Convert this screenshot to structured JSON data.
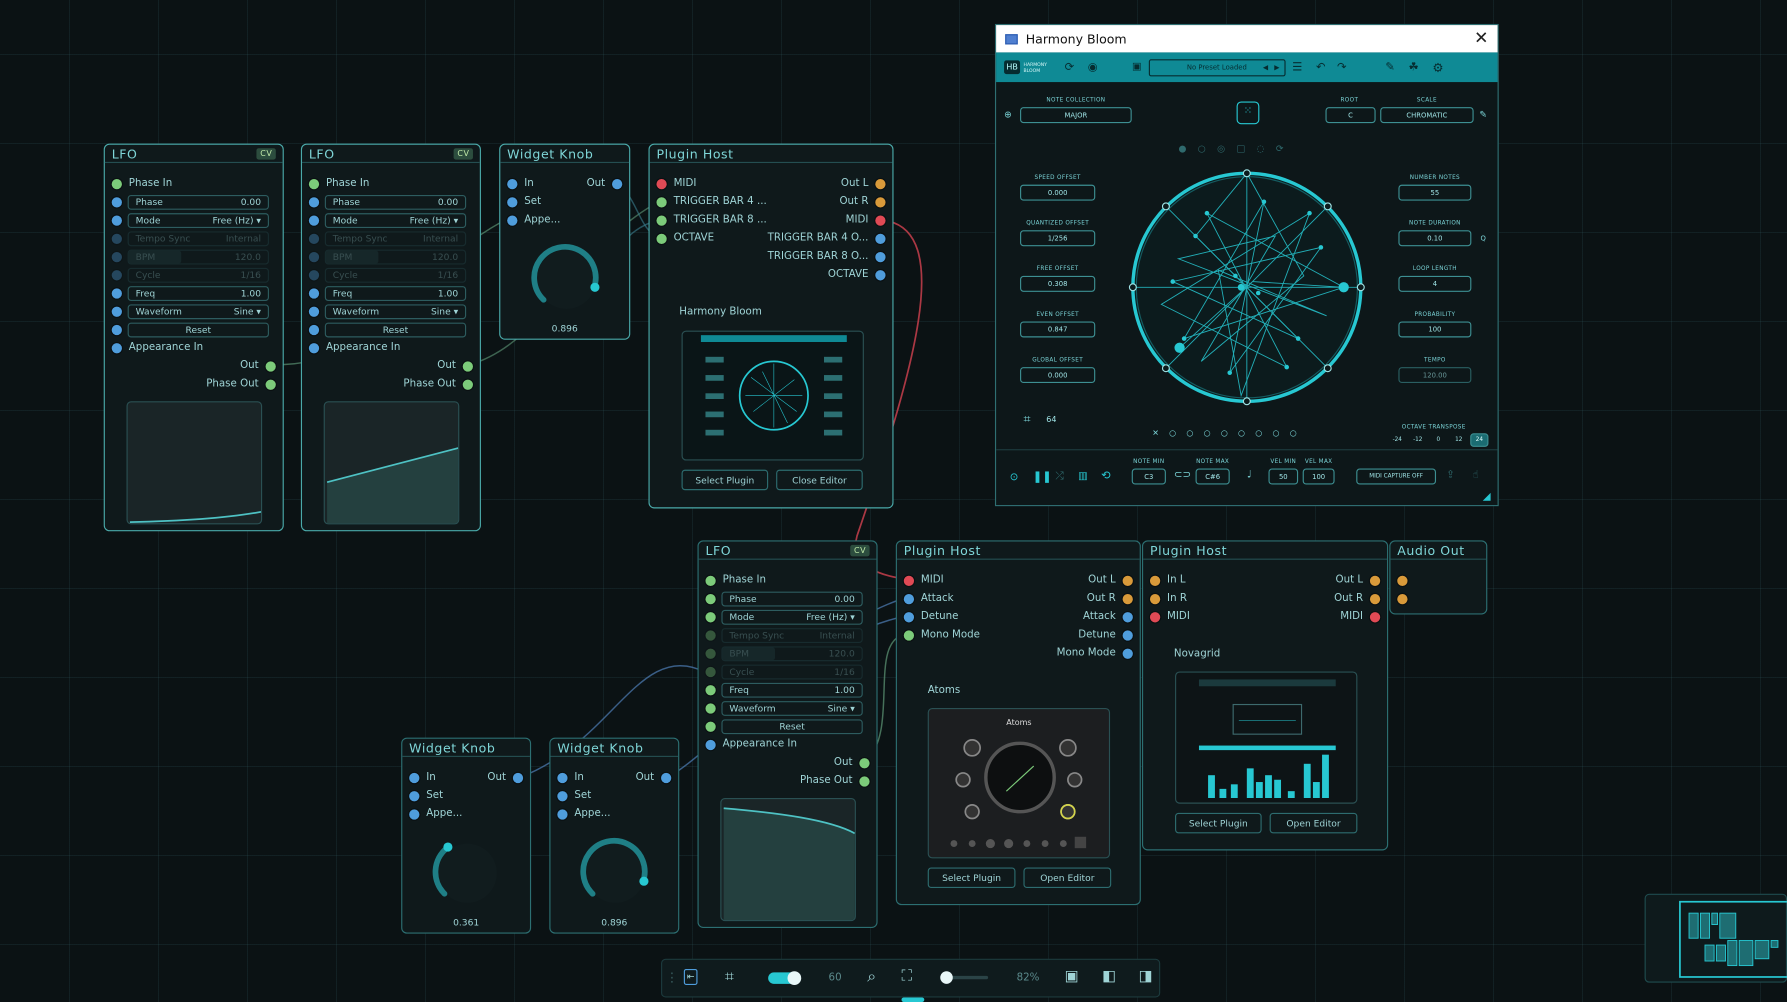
{
  "nodes": {
    "lfo1": {
      "title": "LFO",
      "badge": "CV",
      "phase_in": "Phase In",
      "phase": "Phase",
      "phase_val": "0.00",
      "mode": "Mode",
      "mode_val": "Free (Hz)",
      "tempo_sync": "Tempo Sync",
      "tempo_sync_val": "Internal",
      "bpm": "BPM",
      "bpm_val": "120.0",
      "cycle": "Cycle",
      "cycle_val": "1/16",
      "freq": "Freq",
      "freq_val": "1.00",
      "waveform": "Waveform",
      "waveform_val": "Sine",
      "reset": "Reset",
      "appearance_in": "Appearance In",
      "out": "Out",
      "phase_out": "Phase Out"
    },
    "lfo2": {
      "title": "LFO",
      "badge": "CV",
      "phase_in": "Phase In",
      "phase": "Phase",
      "phase_val": "0.00",
      "mode": "Mode",
      "mode_val": "Free (Hz)",
      "tempo_sync": "Tempo Sync",
      "tempo_sync_val": "Internal",
      "bpm": "BPM",
      "bpm_val": "120.0",
      "cycle": "Cycle",
      "cycle_val": "1/16",
      "freq": "Freq",
      "freq_val": "1.00",
      "waveform": "Waveform",
      "waveform_val": "Sine",
      "reset": "Reset",
      "appearance_in": "Appearance In",
      "out": "Out",
      "phase_out": "Phase Out"
    },
    "lfo3": {
      "title": "LFO",
      "badge": "CV",
      "phase_in": "Phase In",
      "phase": "Phase",
      "phase_val": "0.00",
      "mode": "Mode",
      "mode_val": "Free (Hz)",
      "tempo_sync": "Tempo Sync",
      "tempo_sync_val": "Internal",
      "bpm": "BPM",
      "bpm_val": "120.0",
      "cycle": "Cycle",
      "cycle_val": "1/16",
      "freq": "Freq",
      "freq_val": "1.00",
      "waveform": "Waveform",
      "waveform_val": "Sine",
      "reset": "Reset",
      "appearance_in": "Appearance In",
      "out": "Out",
      "phase_out": "Phase Out"
    },
    "knob1": {
      "title": "Widget Knob",
      "in": "In",
      "set": "Set",
      "appe": "Appe...",
      "out": "Out",
      "value": "0.896"
    },
    "knob2": {
      "title": "Widget Knob",
      "in": "In",
      "set": "Set",
      "appe": "Appe...",
      "out": "Out",
      "value": "0.361"
    },
    "knob3": {
      "title": "Widget Knob",
      "in": "In",
      "set": "Set",
      "appe": "Appe...",
      "out": "Out",
      "value": "0.896"
    },
    "host1": {
      "title": "Plugin Host",
      "midi": "MIDI",
      "trig4": "TRIGGER BAR 4 ...",
      "trig8": "TRIGGER BAR 8 ...",
      "octave": "OCTAVE",
      "out_l": "Out L",
      "out_r": "Out R",
      "midi_out": "MIDI",
      "trig4_out": "TRIGGER BAR 4 O...",
      "trig8_out": "TRIGGER BAR 8 O...",
      "octave_out": "OCTAVE",
      "plugin_name": "Harmony Bloom",
      "select": "Select Plugin",
      "close": "Close Editor"
    },
    "host2": {
      "title": "Plugin Host",
      "midi": "MIDI",
      "attack": "Attack",
      "detune": "Detune",
      "mono": "Mono Mode",
      "out_l": "Out L",
      "out_r": "Out R",
      "attack_out": "Attack",
      "detune_out": "Detune",
      "mono_out": "Mono Mode",
      "plugin_name": "Atoms",
      "thumb_title": "Atoms",
      "select": "Select Plugin",
      "open": "Open Editor"
    },
    "host3": {
      "title": "Plugin Host",
      "in_l": "In L",
      "in_r": "In R",
      "midi": "MIDI",
      "out_l": "Out L",
      "out_r": "Out R",
      "midi_out": "MIDI",
      "plugin_name": "Novagrid",
      "select": "Select Plugin",
      "open": "Open Editor"
    },
    "audio": {
      "title": "Audio Out"
    }
  },
  "harmony": {
    "window_title": "Harmony Bloom",
    "close": "✕",
    "logo": "HB",
    "brand": "HARMONY BLOOM",
    "preset": "No Preset Loaded",
    "note_collection": "NOTE COLLECTION",
    "note_collection_val": "MAJOR",
    "root": "ROOT",
    "root_val": "C",
    "scale": "SCALE",
    "scale_val": "CHROMATIC",
    "left": [
      {
        "label": "SPEED OFFSET",
        "val": "0.000"
      },
      {
        "label": "QUANTIZED OFFSET",
        "val": "1/256"
      },
      {
        "label": "FREE OFFSET",
        "val": "0.308"
      },
      {
        "label": "EVEN OFFSET",
        "val": "0.847"
      },
      {
        "label": "GLOBAL OFFSET",
        "val": "0.000"
      }
    ],
    "right": [
      {
        "label": "NUMBER NOTES",
        "val": "55"
      },
      {
        "label": "NOTE DURATION",
        "val": "0.10"
      },
      {
        "label": "LOOP LENGTH",
        "val": "4"
      },
      {
        "label": "PROBABILITY",
        "val": "100"
      },
      {
        "label": "TEMPO",
        "val": "120.00"
      }
    ],
    "q": "Q",
    "grid_count": "64",
    "octave_transpose": "OCTAVE TRANSPOSE",
    "transpose": [
      "-24",
      "-12",
      "0",
      "12",
      "24"
    ],
    "note_min": "NOTE MIN",
    "note_min_val": "C3",
    "note_max": "NOTE MAX",
    "note_max_val": "C#6",
    "vel_min": "VEL MIN",
    "vel_min_val": "50",
    "vel_max": "VEL MAX",
    "vel_max_val": "100",
    "midi_capture": "MIDI CAPTURE OFF"
  },
  "toolbar": {
    "snap_value": "60",
    "zoom": "82%"
  },
  "colors": {
    "accent": "#27c8d2",
    "port_green": "#7ccb7a",
    "port_blue": "#4f9ddc",
    "port_red": "#e04a55",
    "port_orange": "#d99a3a"
  }
}
